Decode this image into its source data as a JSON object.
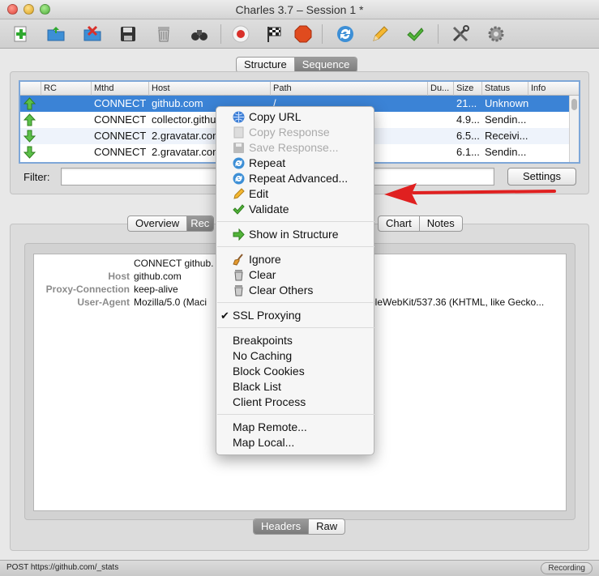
{
  "window": {
    "title": "Charles 3.7 – Session 1 *"
  },
  "toolbar": {
    "icons": [
      "new-session-icon",
      "open-session-icon",
      "close-session-icon",
      "save-icon",
      "trash-icon",
      "find-icon",
      "record-icon",
      "throttle-icon",
      "breakpoint-icon",
      "repeat-icon",
      "edit-icon",
      "validate-icon",
      "tools-icon",
      "settings-gear-icon"
    ]
  },
  "view_tabs": {
    "structure": "Structure",
    "sequence": "Sequence",
    "active": "Sequence"
  },
  "table": {
    "columns": [
      "RC",
      "Mthd",
      "Host",
      "Path",
      "Du...",
      "Size",
      "Status",
      "Info"
    ],
    "rows": [
      {
        "direction": "up",
        "method": "CONNECT",
        "host": "github.com",
        "path": "/",
        "size": "21...",
        "status": "Unknown"
      },
      {
        "direction": "up",
        "method": "CONNECT",
        "host": "collector.github",
        "path": "",
        "size": "4.9...",
        "status": "Sendin..."
      },
      {
        "direction": "down",
        "method": "CONNECT",
        "host": "2.gravatar.com",
        "path": "",
        "size": "6.5...",
        "status": "Receivi..."
      },
      {
        "direction": "down",
        "method": "CONNECT",
        "host": "2.gravatar.com",
        "path": "",
        "size": "6.1...",
        "status": "Sendin..."
      }
    ]
  },
  "filter": {
    "label": "Filter:",
    "value": "",
    "settings_label": "Settings"
  },
  "detail_tabs": [
    "Overview",
    "Rec",
    "Chart",
    "Notes"
  ],
  "detail_tab_active": "Rec",
  "request": {
    "first_line": "CONNECT github.",
    "headers": [
      {
        "key": "Host",
        "value": "github.com"
      },
      {
        "key": "Proxy-Connection",
        "value": "keep-alive"
      },
      {
        "key": "User-Agent",
        "value": "Mozilla/5.0 (Maci",
        "tail": "pleWebKit/537.36 (KHTML, like Gecko..."
      }
    ]
  },
  "format_tabs": {
    "headers": "Headers",
    "raw": "Raw",
    "active": "Headers"
  },
  "status": {
    "text": "POST https://github.com/_stats",
    "recording": "Recording"
  },
  "context_menu": {
    "items": [
      {
        "label": "Copy URL",
        "icon": "globe-icon",
        "enabled": true
      },
      {
        "label": "Copy Response",
        "icon": "document-icon",
        "enabled": false
      },
      {
        "label": "Save Response...",
        "icon": "save-icon",
        "enabled": false
      },
      {
        "label": "Repeat",
        "icon": "repeat-icon",
        "enabled": true
      },
      {
        "label": "Repeat Advanced...",
        "icon": "repeat-icon",
        "enabled": true
      },
      {
        "label": "Edit",
        "icon": "pencil-icon",
        "enabled": true
      },
      {
        "label": "Validate",
        "icon": "checkmark-icon",
        "enabled": true
      },
      {
        "label": "Show in Structure",
        "icon": "green-arrow-icon",
        "enabled": true
      },
      {
        "label": "Ignore",
        "icon": "broom-icon",
        "enabled": true
      },
      {
        "label": "Clear",
        "icon": "trash-icon",
        "enabled": true
      },
      {
        "label": "Clear Others",
        "icon": "trash-icon",
        "enabled": true
      },
      {
        "label": "SSL Proxying",
        "checked": true,
        "enabled": true
      },
      {
        "label": "Breakpoints",
        "enabled": true
      },
      {
        "label": "No Caching",
        "enabled": true
      },
      {
        "label": "Block Cookies",
        "enabled": true
      },
      {
        "label": "Black List",
        "enabled": true
      },
      {
        "label": "Client Process",
        "enabled": true
      },
      {
        "label": "Map Remote...",
        "enabled": true
      },
      {
        "label": "Map Local...",
        "enabled": true
      }
    ]
  },
  "colors": {
    "selection": "#3b83d6",
    "annotation_arrow": "#e02020",
    "table_focus_border": "#7ea7d8"
  }
}
